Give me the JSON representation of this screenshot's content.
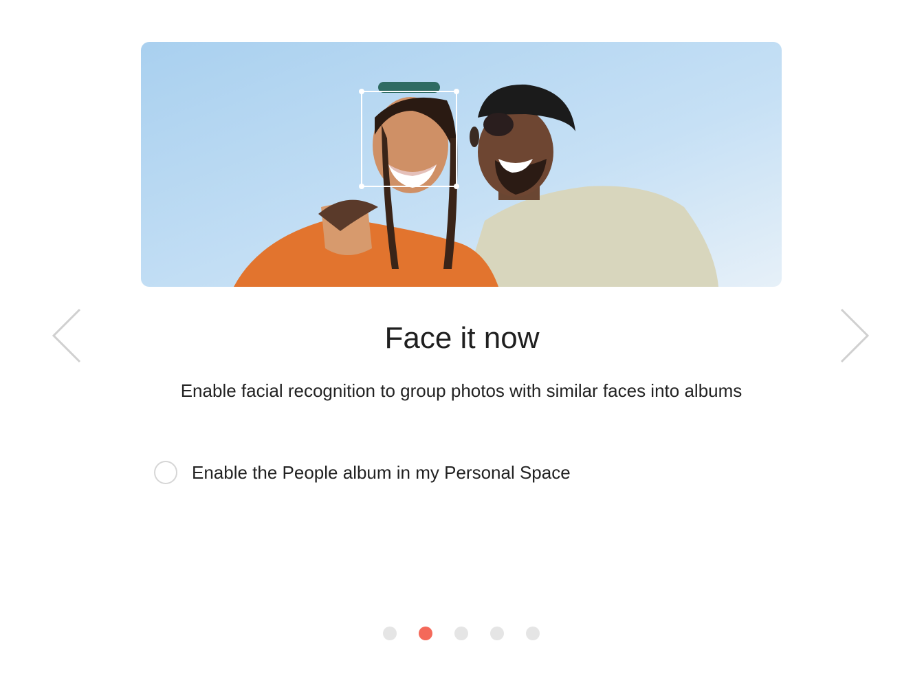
{
  "slide": {
    "title": "Face it now",
    "description": "Enable facial recognition to group photos with similar faces into albums",
    "option_label": "Enable the People album in my Personal Space",
    "option_checked": false
  },
  "pager": {
    "dots": [
      {
        "active": false
      },
      {
        "active": true
      },
      {
        "active": false
      },
      {
        "active": false
      },
      {
        "active": false
      }
    ]
  },
  "icons": {
    "prev": "chevron-left-icon",
    "next": "chevron-right-icon"
  },
  "colors": {
    "accent": "#f4695a",
    "dot_inactive": "#e5e5e5",
    "radio_border": "#d6d6d6",
    "arrow": "#d0d0d0"
  }
}
